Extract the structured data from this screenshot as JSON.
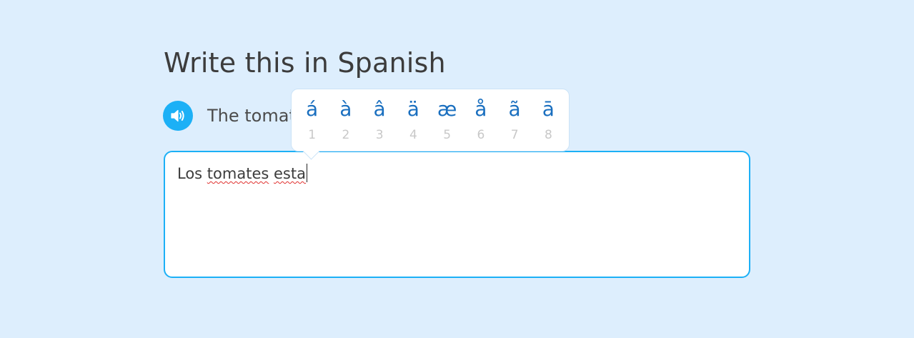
{
  "challenge": {
    "title": "Write this in Spanish",
    "prompt": "The tomat"
  },
  "speaker": {
    "icon": "speaker-icon",
    "color": "#1cb0f6"
  },
  "answer": {
    "words": [
      {
        "text": "Los ",
        "misspelled": false
      },
      {
        "text": "tomates",
        "misspelled": true
      },
      {
        "text": " ",
        "misspelled": false
      },
      {
        "text": "esta",
        "misspelled": true
      }
    ]
  },
  "accent_popup": {
    "keys": [
      {
        "char": "á",
        "shortcut": "1"
      },
      {
        "char": "à",
        "shortcut": "2"
      },
      {
        "char": "â",
        "shortcut": "3"
      },
      {
        "char": "ä",
        "shortcut": "4"
      },
      {
        "char": "æ",
        "shortcut": "5"
      },
      {
        "char": "å",
        "shortcut": "6"
      },
      {
        "char": "ã",
        "shortcut": "7"
      },
      {
        "char": "ā",
        "shortcut": "8"
      }
    ]
  },
  "colors": {
    "background": "#ddeefd",
    "accent": "#1cb0f6",
    "accent_char": "#1a6fbf",
    "misspelling": "#e0302e"
  }
}
